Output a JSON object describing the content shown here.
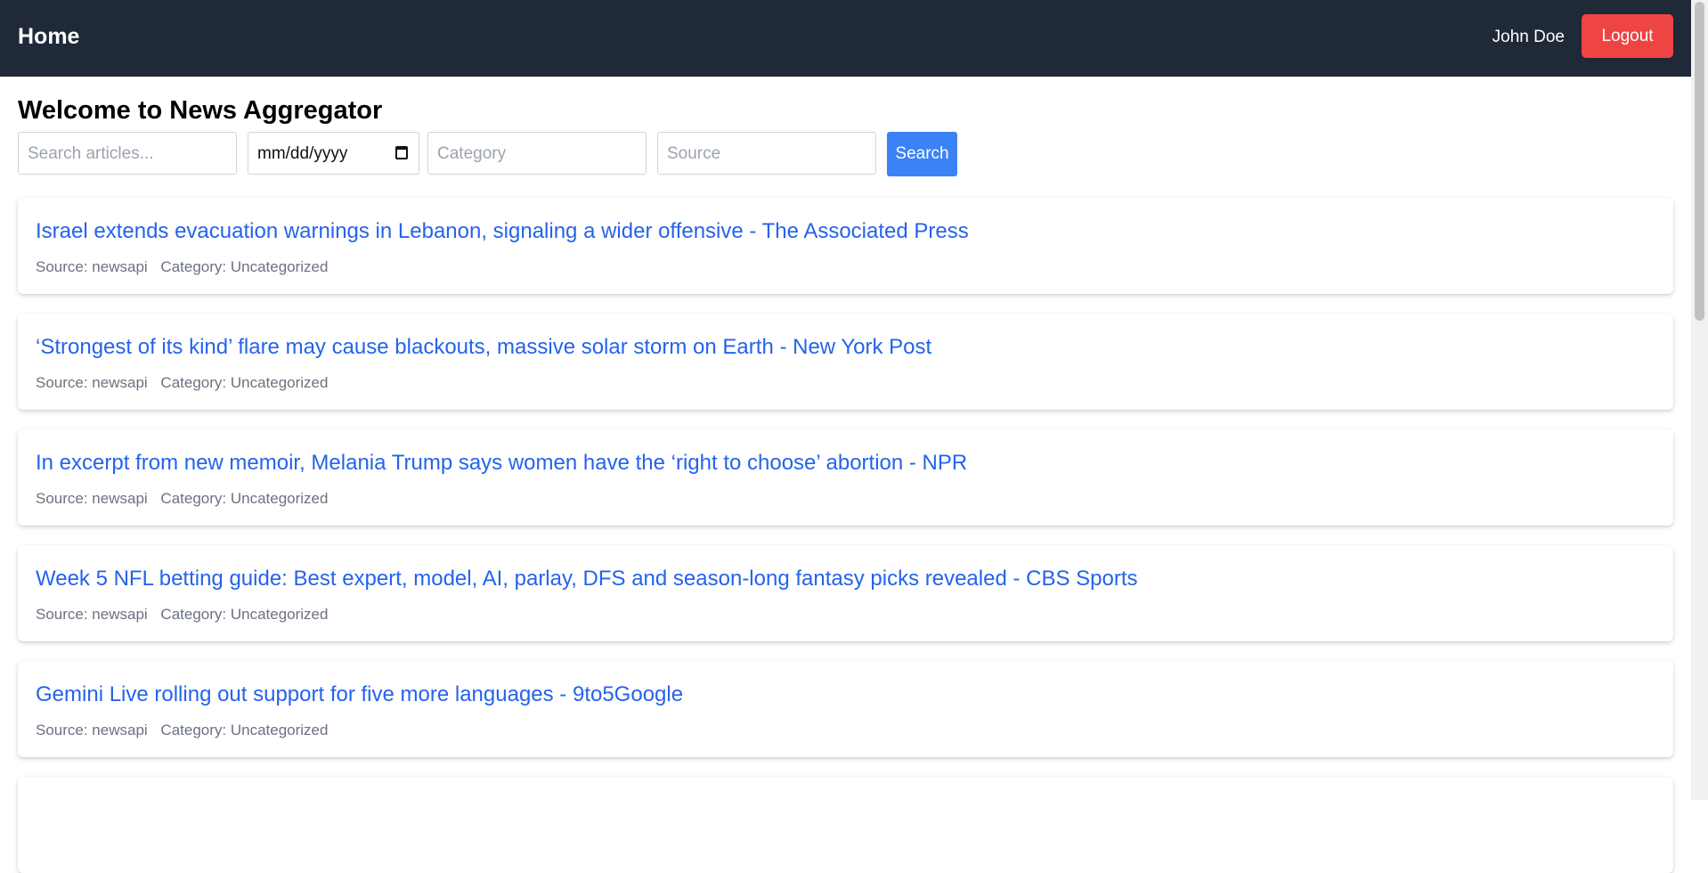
{
  "navbar": {
    "brand": "Home",
    "user_name": "John Doe",
    "logout_label": "Logout"
  },
  "main": {
    "title": "Welcome to News Aggregator",
    "filters": {
      "search_placeholder": "Search articles...",
      "date_placeholder": "mm/dd/yyyy",
      "category_placeholder": "Category",
      "source_placeholder": "Source",
      "search_button": "Search"
    },
    "articles": [
      {
        "title": "Israel extends evacuation warnings in Lebanon, signaling a wider offensive - The Associated Press",
        "source": "Source: newsapi",
        "category": "Category: Uncategorized"
      },
      {
        "title": "‘Strongest of its kind’ flare may cause blackouts, massive solar storm on Earth - New York Post",
        "source": "Source: newsapi",
        "category": "Category: Uncategorized"
      },
      {
        "title": "In excerpt from new memoir, Melania Trump says women have the ‘right to choose’ abortion - NPR",
        "source": "Source: newsapi",
        "category": "Category: Uncategorized"
      },
      {
        "title": "Week 5 NFL betting guide: Best expert, model, AI, parlay, DFS and season-long fantasy picks revealed - CBS Sports",
        "source": "Source: newsapi",
        "category": "Category: Uncategorized"
      },
      {
        "title": "Gemini Live rolling out support for five more languages - 9to5Google",
        "source": "Source: newsapi",
        "category": "Category: Uncategorized"
      }
    ]
  },
  "colors": {
    "navbar_bg": "#1f2937",
    "logout_bg": "#ef4444",
    "search_bg": "#3b82f6",
    "link": "#2563eb",
    "meta_text": "#6b7280"
  }
}
